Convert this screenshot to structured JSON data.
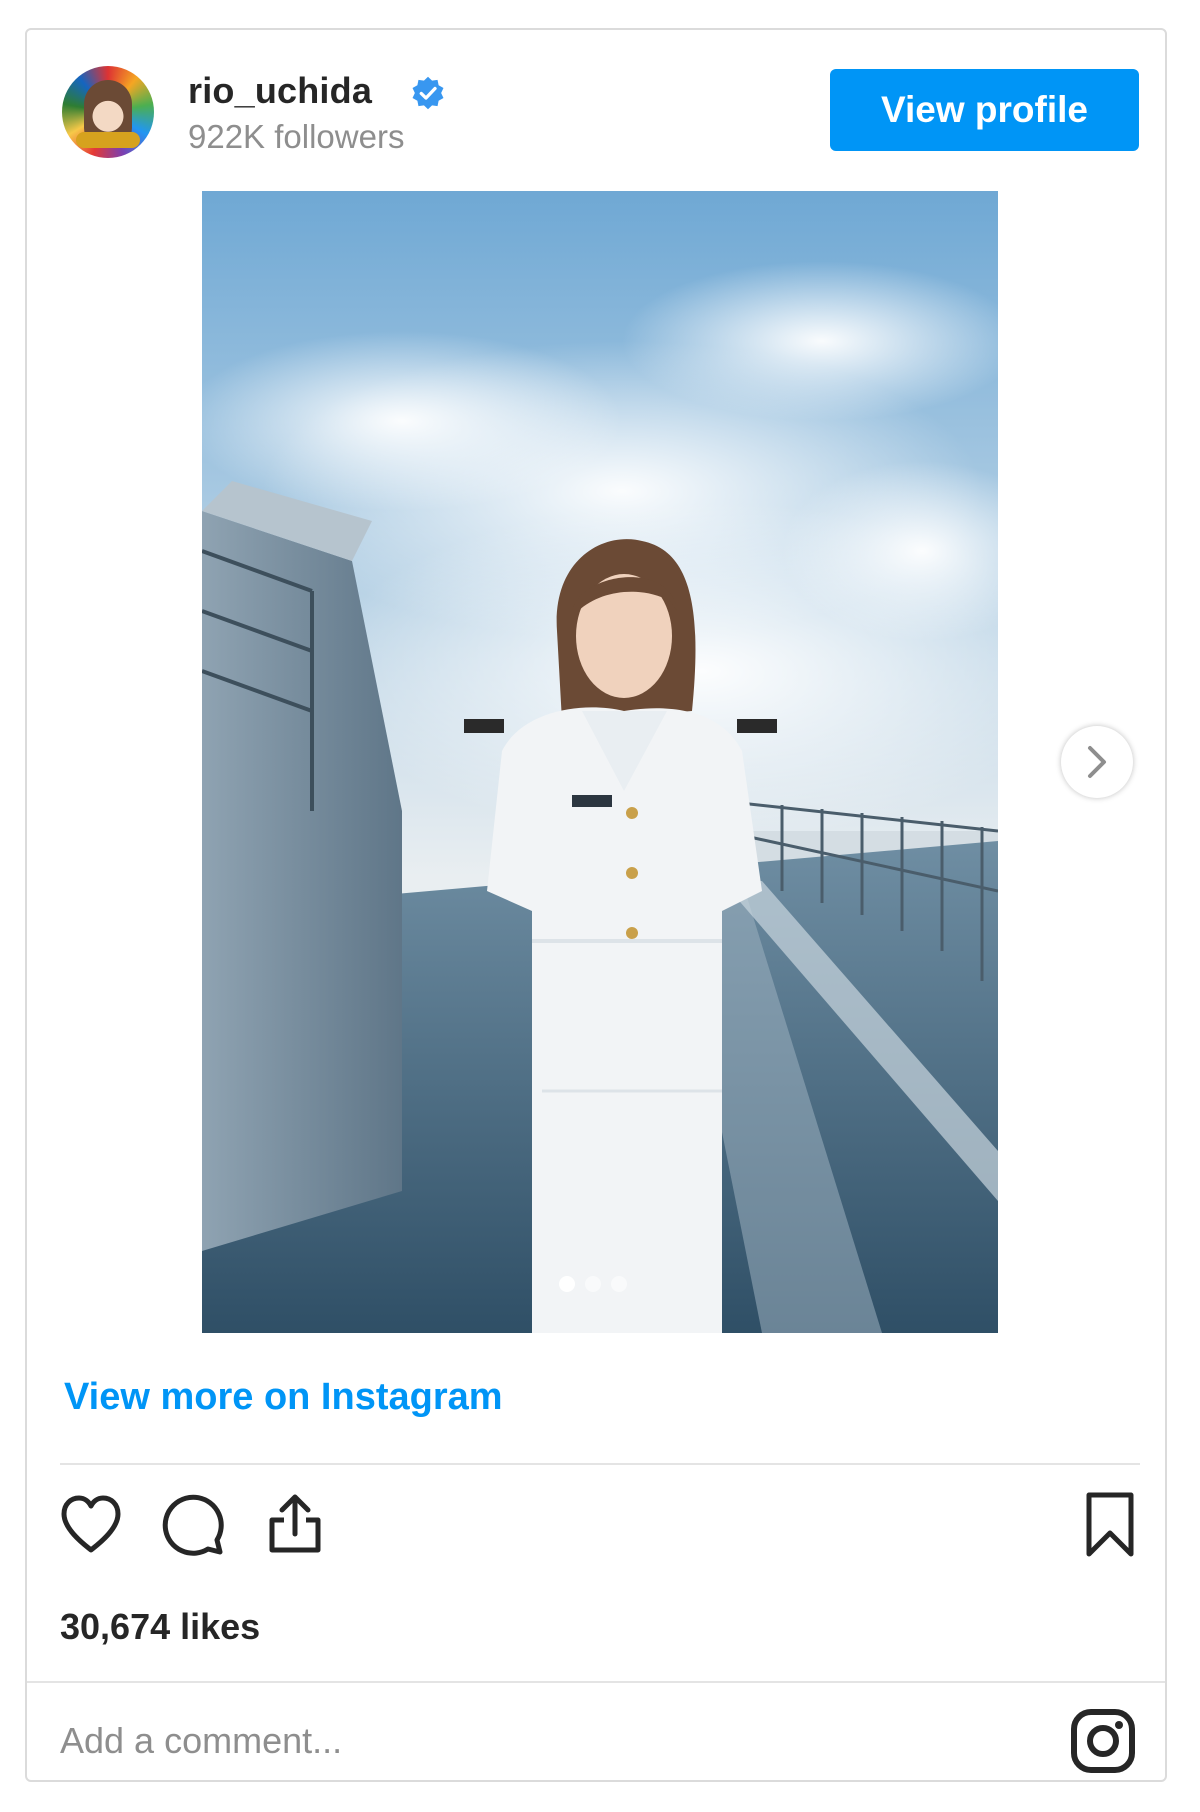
{
  "profile": {
    "username": "rio_uchida",
    "followers": "922K followers",
    "avatar_icon": "avatar",
    "verified_icon": "verified-badge-icon",
    "view_profile_label": "View profile"
  },
  "carousel": {
    "total_slides": 3,
    "active_slide": 1,
    "next_icon": "chevron-right-icon"
  },
  "links": {
    "view_more": "View more on Instagram"
  },
  "actions": {
    "like_icon": "heart-icon",
    "comment_icon": "comment-icon",
    "share_icon": "share-icon",
    "save_icon": "bookmark-icon"
  },
  "stats": {
    "likes": "30,674 likes"
  },
  "comment": {
    "placeholder": "Add a comment...",
    "logo_icon": "instagram-logo-icon"
  },
  "colors": {
    "accent": "#0095f6",
    "text": "#262626",
    "muted": "#8e8e8e",
    "border": "#dbdbdb"
  }
}
